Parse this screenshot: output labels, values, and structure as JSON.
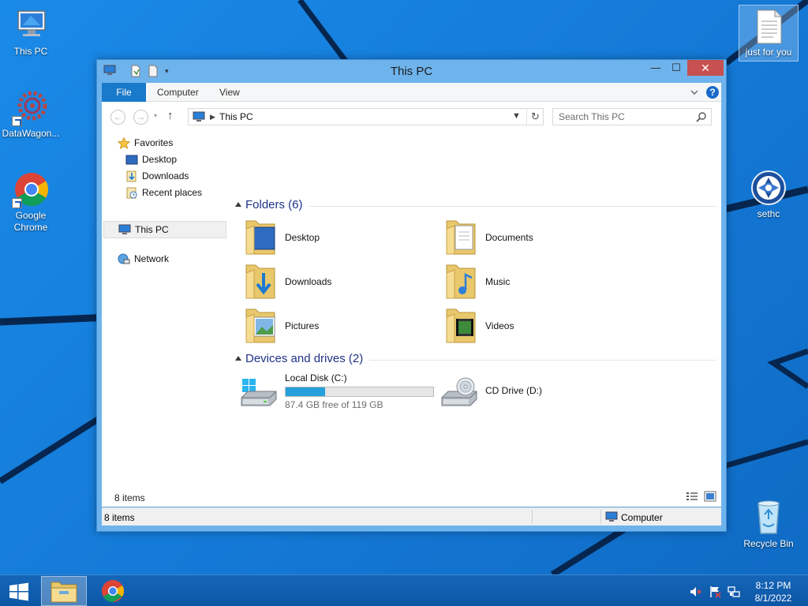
{
  "desktop": {
    "icons": {
      "this_pc": "This PC",
      "datawagon": "DataWagon...",
      "chrome": "Google\nChrome",
      "just_for_you": "just for you",
      "sethc": "sethc",
      "recycle_bin": "Recycle Bin"
    }
  },
  "window": {
    "title": "This PC",
    "ribbon_tabs": [
      "File",
      "Computer",
      "View"
    ],
    "address": "This PC",
    "search_placeholder": "Search This PC",
    "nav_pane": {
      "favorites": "Favorites",
      "favorites_items": [
        "Desktop",
        "Downloads",
        "Recent places"
      ],
      "this_pc": "This PC",
      "network": "Network"
    },
    "folders_header": "Folders (6)",
    "folders": [
      "Desktop",
      "Documents",
      "Downloads",
      "Music",
      "Pictures",
      "Videos"
    ],
    "devices_header": "Devices and drives (2)",
    "drives": {
      "local_disk": {
        "name": "Local Disk (C:)",
        "free_text": "87.4 GB free of 119 GB",
        "used_fraction": 0.265
      },
      "cd_drive": {
        "name": "CD Drive (D:)"
      }
    },
    "item_count": "8 items",
    "status": {
      "count": "8 items",
      "location": "Computer"
    }
  },
  "taskbar": {
    "time": "8:12 PM",
    "date": "8/1/2022"
  },
  "colors": {
    "accent": "#1979ca",
    "desktop": "#1479d6",
    "taskbar": "#0d56a6",
    "drive_bar": "#26a0da"
  }
}
